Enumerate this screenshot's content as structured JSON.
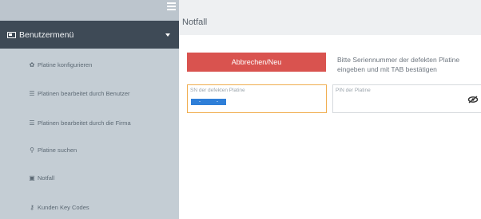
{
  "sidebar": {
    "header": {
      "label": "Benutzermenü"
    },
    "items": [
      {
        "label": "Platine konfigurieren",
        "icon": "gear-icon"
      },
      {
        "label": "Platinen bearbeitet durch Benutzer",
        "icon": "list-icon"
      },
      {
        "label": "Platinen bearbeitet durch die Firma",
        "icon": "list-icon"
      },
      {
        "label": "Platine suchen",
        "icon": "search-icon"
      },
      {
        "label": "Notfall",
        "icon": "ambulance-icon"
      },
      {
        "label": "Kunden Key Codes",
        "icon": "key-icon"
      }
    ]
  },
  "main": {
    "title": "Notfall",
    "cancel_button": "Abbrechen/Neu",
    "hint": "Bitte Seriennummer der defekten Platine eingeben und mit TAB bestätigen",
    "sn_field": {
      "label": "SN der defekten Platine",
      "select_left": "-",
      "select_right": "-"
    },
    "pin_field": {
      "label": "PIN der Platine"
    }
  },
  "colors": {
    "accent_red": "#d9534f",
    "sidebar_dark": "#3e4a56",
    "select_blue": "#2f7fd8",
    "focus_orange": "#f0ad4e"
  }
}
